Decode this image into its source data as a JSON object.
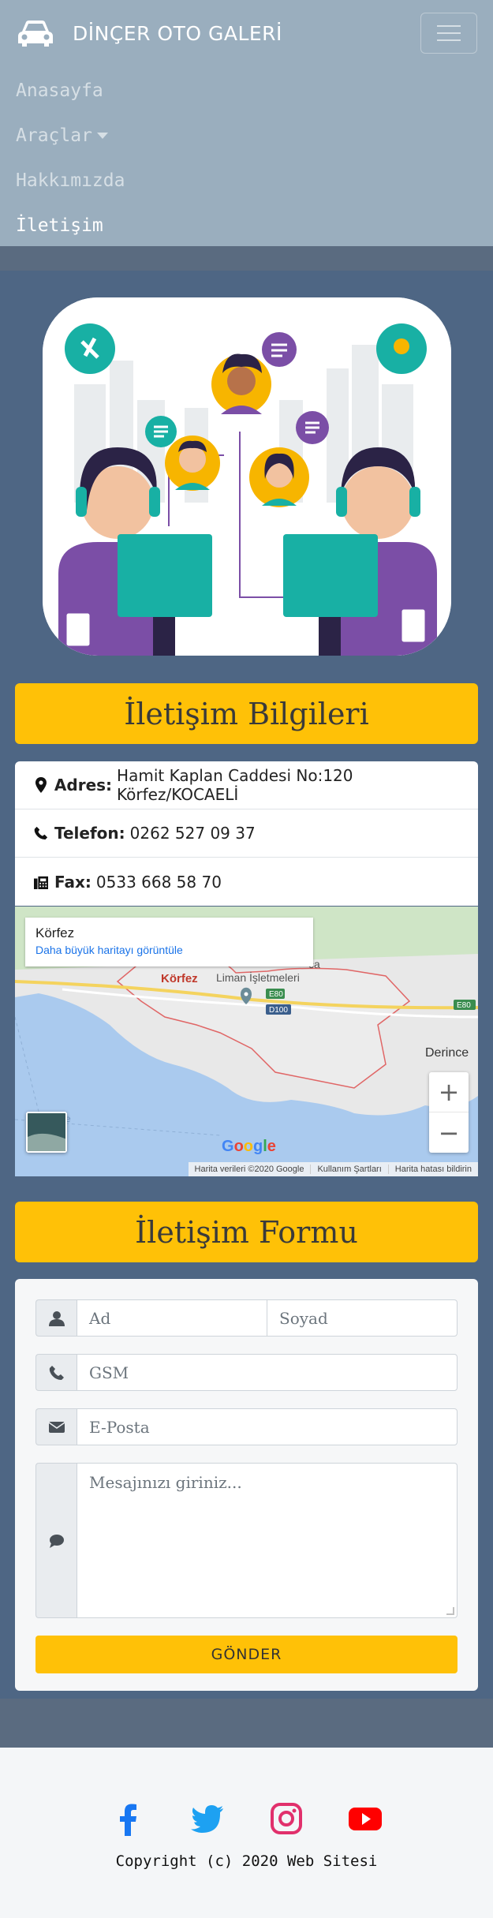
{
  "brand": {
    "name": "DİNÇER OTO GALERİ",
    "icon": "car-icon"
  },
  "nav": {
    "items": [
      {
        "label": "Anasayfa"
      },
      {
        "label": "Araçlar"
      },
      {
        "label": "Hakkımızda"
      },
      {
        "label": "İletişim"
      }
    ]
  },
  "contact": {
    "title": "İletişim Bilgileri",
    "address_label": "Adres:",
    "address": "Hamit Kaplan Caddesi No:120 Körfez/KOCAELİ",
    "phone_label": "Telefon:",
    "phone": "0262 527 09 37",
    "fax_label": "Fax:",
    "fax": "0533 668 58 70"
  },
  "map": {
    "place": "Körfez",
    "bigger_map_link": "Daha büyük haritayı görüntüle",
    "labels": {
      "korfez": "Körfez",
      "liman": "Liman İşletmeleri",
      "derince": "Derince",
      "e80": "E80",
      "d100": "D100",
      "e80b": "E80",
      "ca": "ca",
      "erince": "erince"
    },
    "zoom_in": "+",
    "zoom_out": "−",
    "google": "Google",
    "footer": [
      "Harita verileri ©2020 Google",
      "Kullanım Şartları",
      "Harita hatası bildirin"
    ]
  },
  "form": {
    "title": "İletişim Formu",
    "first_name_placeholder": "Ad",
    "last_name_placeholder": "Soyad",
    "gsm_placeholder": "GSM",
    "email_placeholder": "E-Posta",
    "message_placeholder": "Mesajınızı giriniz...",
    "submit_label": "GÖNDER"
  },
  "footer": {
    "social": [
      "facebook-icon",
      "twitter-icon",
      "instagram-icon",
      "youtube-icon"
    ],
    "copyright": "Copyright (c) 2020 Web Sitesi"
  },
  "colors": {
    "accent": "#ffc107",
    "navbar": "#9aaebe",
    "main_bg": "#4e6684",
    "facebook": "#1877f2",
    "twitter": "#1da1f2",
    "instagram": "#e1306c",
    "youtube": "#ff0000"
  }
}
